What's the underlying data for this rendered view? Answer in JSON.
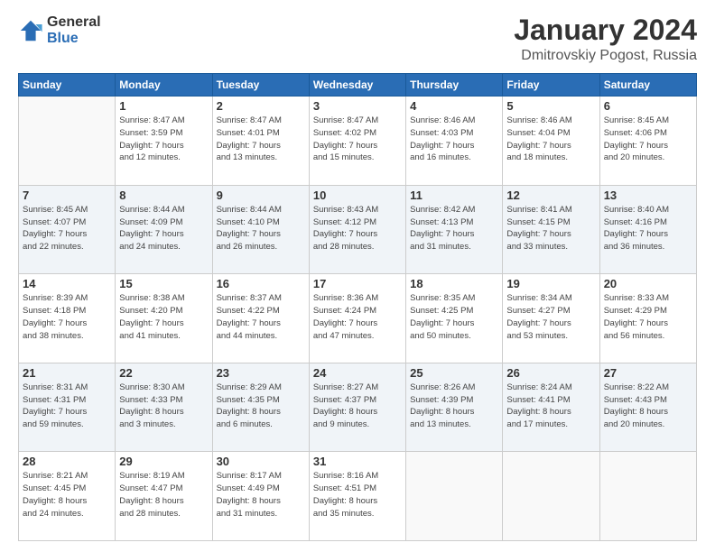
{
  "logo": {
    "line1": "General",
    "line2": "Blue"
  },
  "header": {
    "month": "January 2024",
    "location": "Dmitrovskiy Pogost, Russia"
  },
  "days_of_week": [
    "Sunday",
    "Monday",
    "Tuesday",
    "Wednesday",
    "Thursday",
    "Friday",
    "Saturday"
  ],
  "weeks": [
    [
      {
        "day": "",
        "info": ""
      },
      {
        "day": "1",
        "info": "Sunrise: 8:47 AM\nSunset: 3:59 PM\nDaylight: 7 hours\nand 12 minutes."
      },
      {
        "day": "2",
        "info": "Sunrise: 8:47 AM\nSunset: 4:01 PM\nDaylight: 7 hours\nand 13 minutes."
      },
      {
        "day": "3",
        "info": "Sunrise: 8:47 AM\nSunset: 4:02 PM\nDaylight: 7 hours\nand 15 minutes."
      },
      {
        "day": "4",
        "info": "Sunrise: 8:46 AM\nSunset: 4:03 PM\nDaylight: 7 hours\nand 16 minutes."
      },
      {
        "day": "5",
        "info": "Sunrise: 8:46 AM\nSunset: 4:04 PM\nDaylight: 7 hours\nand 18 minutes."
      },
      {
        "day": "6",
        "info": "Sunrise: 8:45 AM\nSunset: 4:06 PM\nDaylight: 7 hours\nand 20 minutes."
      }
    ],
    [
      {
        "day": "7",
        "info": "Sunrise: 8:45 AM\nSunset: 4:07 PM\nDaylight: 7 hours\nand 22 minutes."
      },
      {
        "day": "8",
        "info": "Sunrise: 8:44 AM\nSunset: 4:09 PM\nDaylight: 7 hours\nand 24 minutes."
      },
      {
        "day": "9",
        "info": "Sunrise: 8:44 AM\nSunset: 4:10 PM\nDaylight: 7 hours\nand 26 minutes."
      },
      {
        "day": "10",
        "info": "Sunrise: 8:43 AM\nSunset: 4:12 PM\nDaylight: 7 hours\nand 28 minutes."
      },
      {
        "day": "11",
        "info": "Sunrise: 8:42 AM\nSunset: 4:13 PM\nDaylight: 7 hours\nand 31 minutes."
      },
      {
        "day": "12",
        "info": "Sunrise: 8:41 AM\nSunset: 4:15 PM\nDaylight: 7 hours\nand 33 minutes."
      },
      {
        "day": "13",
        "info": "Sunrise: 8:40 AM\nSunset: 4:16 PM\nDaylight: 7 hours\nand 36 minutes."
      }
    ],
    [
      {
        "day": "14",
        "info": "Sunrise: 8:39 AM\nSunset: 4:18 PM\nDaylight: 7 hours\nand 38 minutes."
      },
      {
        "day": "15",
        "info": "Sunrise: 8:38 AM\nSunset: 4:20 PM\nDaylight: 7 hours\nand 41 minutes."
      },
      {
        "day": "16",
        "info": "Sunrise: 8:37 AM\nSunset: 4:22 PM\nDaylight: 7 hours\nand 44 minutes."
      },
      {
        "day": "17",
        "info": "Sunrise: 8:36 AM\nSunset: 4:24 PM\nDaylight: 7 hours\nand 47 minutes."
      },
      {
        "day": "18",
        "info": "Sunrise: 8:35 AM\nSunset: 4:25 PM\nDaylight: 7 hours\nand 50 minutes."
      },
      {
        "day": "19",
        "info": "Sunrise: 8:34 AM\nSunset: 4:27 PM\nDaylight: 7 hours\nand 53 minutes."
      },
      {
        "day": "20",
        "info": "Sunrise: 8:33 AM\nSunset: 4:29 PM\nDaylight: 7 hours\nand 56 minutes."
      }
    ],
    [
      {
        "day": "21",
        "info": "Sunrise: 8:31 AM\nSunset: 4:31 PM\nDaylight: 7 hours\nand 59 minutes."
      },
      {
        "day": "22",
        "info": "Sunrise: 8:30 AM\nSunset: 4:33 PM\nDaylight: 8 hours\nand 3 minutes."
      },
      {
        "day": "23",
        "info": "Sunrise: 8:29 AM\nSunset: 4:35 PM\nDaylight: 8 hours\nand 6 minutes."
      },
      {
        "day": "24",
        "info": "Sunrise: 8:27 AM\nSunset: 4:37 PM\nDaylight: 8 hours\nand 9 minutes."
      },
      {
        "day": "25",
        "info": "Sunrise: 8:26 AM\nSunset: 4:39 PM\nDaylight: 8 hours\nand 13 minutes."
      },
      {
        "day": "26",
        "info": "Sunrise: 8:24 AM\nSunset: 4:41 PM\nDaylight: 8 hours\nand 17 minutes."
      },
      {
        "day": "27",
        "info": "Sunrise: 8:22 AM\nSunset: 4:43 PM\nDaylight: 8 hours\nand 20 minutes."
      }
    ],
    [
      {
        "day": "28",
        "info": "Sunrise: 8:21 AM\nSunset: 4:45 PM\nDaylight: 8 hours\nand 24 minutes."
      },
      {
        "day": "29",
        "info": "Sunrise: 8:19 AM\nSunset: 4:47 PM\nDaylight: 8 hours\nand 28 minutes."
      },
      {
        "day": "30",
        "info": "Sunrise: 8:17 AM\nSunset: 4:49 PM\nDaylight: 8 hours\nand 31 minutes."
      },
      {
        "day": "31",
        "info": "Sunrise: 8:16 AM\nSunset: 4:51 PM\nDaylight: 8 hours\nand 35 minutes."
      },
      {
        "day": "",
        "info": ""
      },
      {
        "day": "",
        "info": ""
      },
      {
        "day": "",
        "info": ""
      }
    ]
  ]
}
